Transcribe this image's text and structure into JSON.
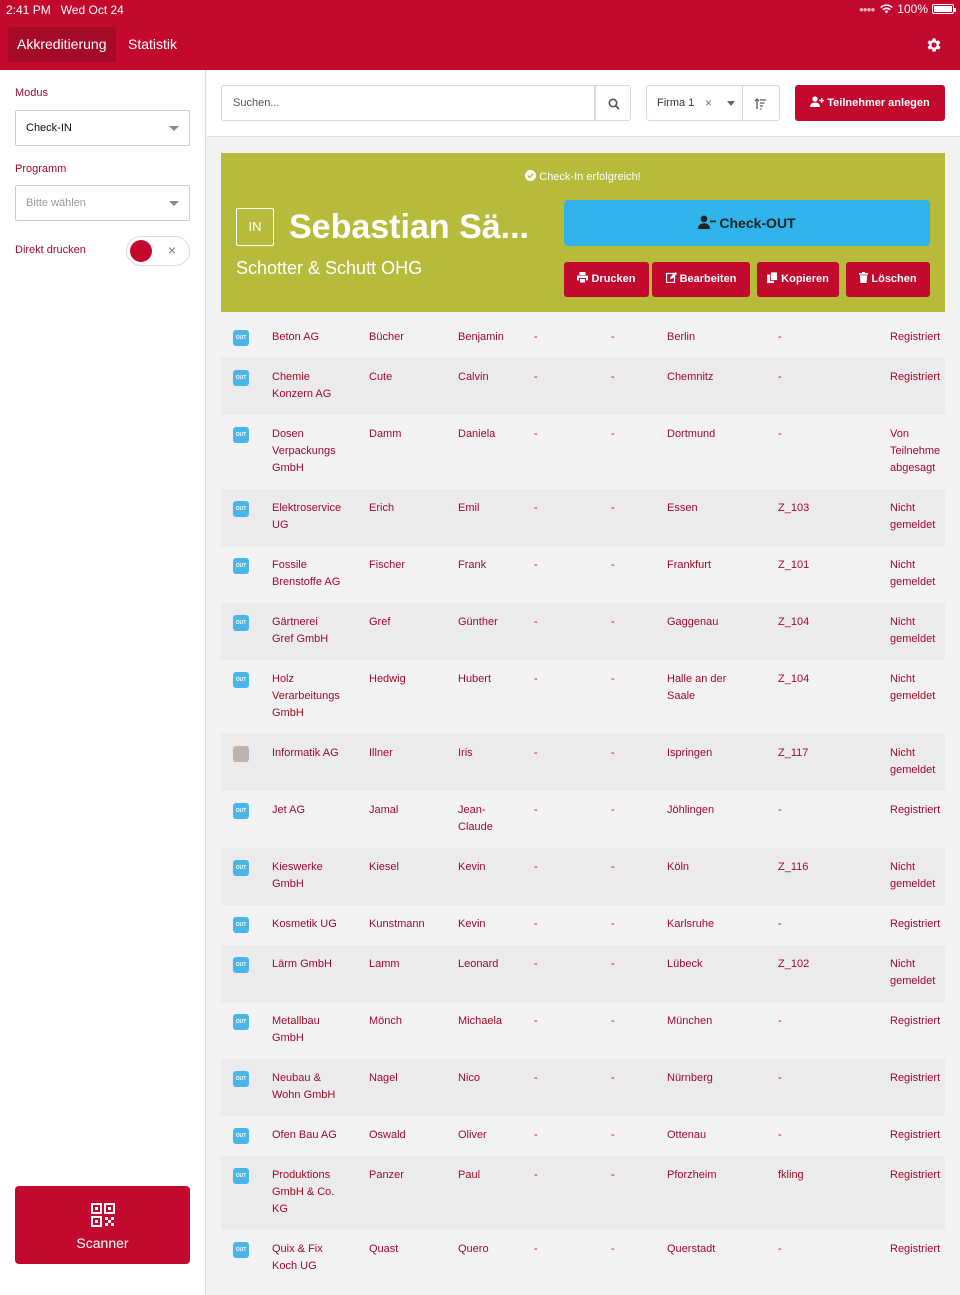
{
  "statusbar": {
    "time": "2:41 PM",
    "date": "Wed Oct 24",
    "battery": "100%"
  },
  "nav": {
    "tabs": [
      "Akkreditierung",
      "Statistik"
    ],
    "settings_icon": "gear-icon"
  },
  "sidebar": {
    "mode_label": "Modus",
    "mode_value": "Check-IN",
    "program_label": "Programm",
    "program_placeholder": "Bitte wählen",
    "direct_print_label": "Direkt drucken",
    "direct_print_on": true,
    "toggle_x": "×",
    "scanner_label": "Scanner"
  },
  "toolbar": {
    "search_placeholder": "Suchen...",
    "filter_value": "Firma 1",
    "filter_clear": "×",
    "add_label": "Teilnehmer anlegen"
  },
  "banner": {
    "message": "Check-In erfolgreich!",
    "badge": "IN",
    "name": "Sebastian Sä...",
    "company": "Schotter & Schutt OHG",
    "checkout_label": "Check-OUT",
    "print_label": "Drucken",
    "edit_label": "Bearbeiten",
    "copy_label": "Kopieren",
    "delete_label": "Löschen",
    "color": "#b7bb3b"
  },
  "colors": {
    "brand": "#c4092f",
    "accent": "#2fb3ea",
    "out_badge": "#4ab5e8"
  },
  "rows": [
    {
      "badge": "OUT",
      "company": "Beton AG",
      "lastname": "Bücher",
      "firstname": "Benjamin",
      "c1": "-",
      "c2": "-",
      "city": "Berlin",
      "code": "-",
      "status": "Registriert"
    },
    {
      "badge": "OUT",
      "company": "Chemie\nKonzern AG",
      "lastname": "Cute",
      "firstname": "Calvin",
      "c1": "-",
      "c2": "-",
      "city": "Chemnitz",
      "code": "-",
      "status": "Registriert"
    },
    {
      "badge": "OUT",
      "company": "Dosen\nVerpackungs\nGmbH",
      "lastname": "Damm",
      "firstname": "Daniela",
      "c1": "-",
      "c2": "-",
      "city": "Dortmund",
      "code": "-",
      "status": "Von\nTeilnehme\nabgesagt"
    },
    {
      "badge": "OUT",
      "company": "Elektroservice\nUG",
      "lastname": "Erich",
      "firstname": "Emil",
      "c1": "-",
      "c2": "-",
      "city": "Essen",
      "code": "Z_103",
      "status": "Nicht\ngemeldet"
    },
    {
      "badge": "OUT",
      "company": "Fossile\nBrenstoffe AG",
      "lastname": "Fischer",
      "firstname": "Frank",
      "c1": "-",
      "c2": "-",
      "city": "Frankfurt",
      "code": "Z_101",
      "status": "Nicht\ngemeldet"
    },
    {
      "badge": "OUT",
      "company": "Gärtnerei\nGref GmbH",
      "lastname": "Gref",
      "firstname": "Günther",
      "c1": "-",
      "c2": "-",
      "city": "Gaggenau",
      "code": "Z_104",
      "status": "Nicht\ngemeldet"
    },
    {
      "badge": "OUT",
      "company": "Holz\nVerarbeitungs\nGmbH",
      "lastname": "Hedwig",
      "firstname": "Hubert",
      "c1": "-",
      "c2": "-",
      "city": "Halle an der\nSaale",
      "code": "Z_104",
      "status": "Nicht\ngemeldet"
    },
    {
      "badge": "",
      "company": "Informatik AG",
      "lastname": "Illner",
      "firstname": "Iris",
      "c1": "-",
      "c2": "-",
      "city": "Ispringen",
      "code": "Z_117",
      "status": "Nicht\ngemeldet"
    },
    {
      "badge": "OUT",
      "company": "Jet AG",
      "lastname": "Jamal",
      "firstname": "Jean-\nClaude",
      "c1": "-",
      "c2": "-",
      "city": "Jöhlingen",
      "code": "-",
      "status": "Registriert"
    },
    {
      "badge": "OUT",
      "company": "Kieswerke\nGmbH",
      "lastname": "Kiesel",
      "firstname": "Kevin",
      "c1": "-",
      "c2": "-",
      "city": "Köln",
      "code": "Z_116",
      "status": "Nicht\ngemeldet"
    },
    {
      "badge": "OUT",
      "company": "Kosmetik UG",
      "lastname": "Kunstmann",
      "firstname": "Kevin",
      "c1": "-",
      "c2": "-",
      "city": "Karlsruhe",
      "code": "-",
      "status": "Registriert"
    },
    {
      "badge": "OUT",
      "company": "Lärm GmbH",
      "lastname": "Lamm",
      "firstname": "Leonard",
      "c1": "-",
      "c2": "-",
      "city": "Lübeck",
      "code": "Z_102",
      "status": "Nicht\ngemeldet"
    },
    {
      "badge": "OUT",
      "company": "Metallbau\nGmbH",
      "lastname": "Mönch",
      "firstname": "Michaela",
      "c1": "-",
      "c2": "-",
      "city": "München",
      "code": "-",
      "status": "Registriert"
    },
    {
      "badge": "OUT",
      "company": "Neubau &\nWohn GmbH",
      "lastname": "Nagel",
      "firstname": "Nico",
      "c1": "-",
      "c2": "-",
      "city": "Nürnberg",
      "code": "-",
      "status": "Registriert"
    },
    {
      "badge": "OUT",
      "company": "Ofen Bau AG",
      "lastname": "Oswald",
      "firstname": "Oliver",
      "c1": "-",
      "c2": "-",
      "city": "Ottenau",
      "code": "-",
      "status": "Registriert"
    },
    {
      "badge": "OUT",
      "company": "Produktions\nGmbH & Co.\nKG",
      "lastname": "Panzer",
      "firstname": "Paul",
      "c1": "-",
      "c2": "-",
      "city": "Pforzheim",
      "code": "fkling",
      "status": "Registriert"
    },
    {
      "badge": "OUT",
      "company": "Quix & Fix\nKoch UG",
      "lastname": "Quast",
      "firstname": "Quero",
      "c1": "-",
      "c2": "-",
      "city": "Querstadt",
      "code": "-",
      "status": "Registriert"
    }
  ]
}
